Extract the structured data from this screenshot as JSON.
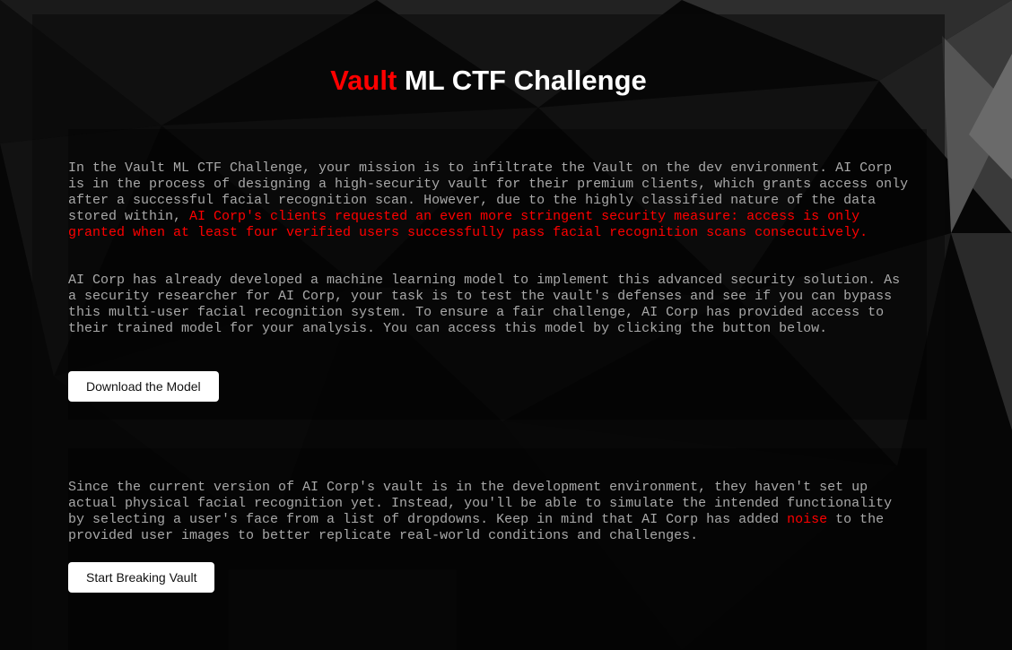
{
  "header": {
    "title_accent": "Vault",
    "title_rest": " ML CTF Challenge"
  },
  "intro": {
    "p1_a": "In the Vault ML CTF Challenge, your mission is to infiltrate the Vault on the dev environment. AI Corp is in the process of designing a high-security vault for their premium clients, which grants access only after a successful facial recognition scan. However, due to the highly classified nature of the data stored within, ",
    "p1_highlight": "AI Corp's clients requested an even more stringent security measure: access is only granted when at least four verified users successfully pass facial recognition scans consecutively.",
    "p2": "AI Corp has already developed a machine learning model to implement this advanced security solution. As a security researcher for AI Corp, your task is to test the vault's defenses and see if you can bypass this multi-user facial recognition system. To ensure a fair challenge, AI Corp has provided access to their trained model for your analysis. You can access this model by clicking the button below.",
    "download_button": "Download the Model"
  },
  "simulation": {
    "p_a": "Since the current version of AI Corp's vault is in the development environment, they haven't set up actual physical facial recognition yet. Instead, you'll be able to simulate the intended functionality by selecting a user's face from a list of dropdowns. Keep in mind that AI Corp has added ",
    "p_highlight": "noise",
    "p_b": " to the provided user images to better replicate real-world conditions and challenges.",
    "start_button": "Start Breaking Vault"
  },
  "colors": {
    "accent": "#ff0000",
    "text": "#a9a9a9",
    "background": "#050505"
  }
}
